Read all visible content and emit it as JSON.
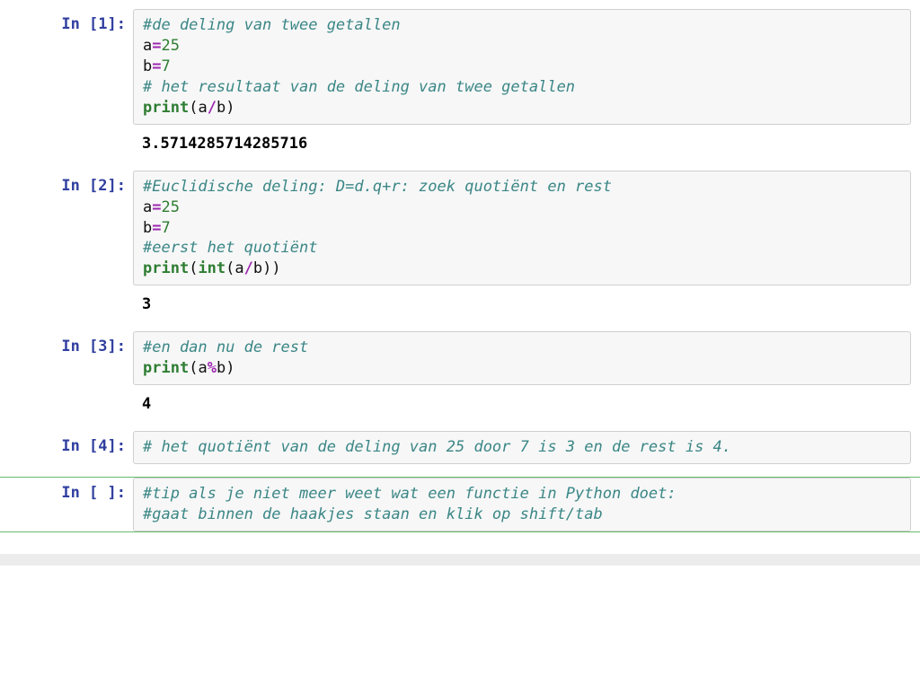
{
  "cells": [
    {
      "prompt": "In [1]:",
      "code": [
        {
          "t": "c",
          "v": "#de deling van twee getallen"
        },
        [
          {
            "t": "n",
            "v": "a"
          },
          {
            "t": "o",
            "v": "="
          },
          {
            "t": "num",
            "v": "25"
          }
        ],
        [
          {
            "t": "n",
            "v": "b"
          },
          {
            "t": "o",
            "v": "="
          },
          {
            "t": "num",
            "v": "7"
          }
        ],
        {
          "t": "c",
          "v": "# het resultaat van de deling van twee getallen"
        },
        [
          {
            "t": "k",
            "v": "print"
          },
          {
            "t": "p",
            "v": "("
          },
          {
            "t": "n",
            "v": "a"
          },
          {
            "t": "o",
            "v": "/"
          },
          {
            "t": "n",
            "v": "b"
          },
          {
            "t": "p",
            "v": ")"
          }
        ]
      ],
      "output": "3.5714285714285716"
    },
    {
      "prompt": "In [2]:",
      "code": [
        {
          "t": "c",
          "v": "#Euclidische deling: D=d.q+r: zoek quotiënt en rest"
        },
        [
          {
            "t": "n",
            "v": "a"
          },
          {
            "t": "o",
            "v": "="
          },
          {
            "t": "num",
            "v": "25"
          }
        ],
        [
          {
            "t": "n",
            "v": "b"
          },
          {
            "t": "o",
            "v": "="
          },
          {
            "t": "num",
            "v": "7"
          }
        ],
        {
          "t": "c",
          "v": "#eerst het quotiënt"
        },
        [
          {
            "t": "k",
            "v": "print"
          },
          {
            "t": "p",
            "v": "("
          },
          {
            "t": "k",
            "v": "int"
          },
          {
            "t": "p",
            "v": "("
          },
          {
            "t": "n",
            "v": "a"
          },
          {
            "t": "o",
            "v": "/"
          },
          {
            "t": "n",
            "v": "b"
          },
          {
            "t": "p",
            "v": "))"
          }
        ]
      ],
      "output": "3"
    },
    {
      "prompt": "In [3]:",
      "code": [
        {
          "t": "c",
          "v": "#en dan nu de rest"
        },
        [
          {
            "t": "k",
            "v": "print"
          },
          {
            "t": "p",
            "v": "("
          },
          {
            "t": "n",
            "v": "a"
          },
          {
            "t": "o",
            "v": "%"
          },
          {
            "t": "n",
            "v": "b"
          },
          {
            "t": "p",
            "v": ")"
          }
        ]
      ],
      "output": "4"
    },
    {
      "prompt": "In [4]:",
      "code": [
        {
          "t": "c",
          "v": "# het quotiënt van de deling van 25 door 7 is 3 en de rest is 4."
        }
      ],
      "output": null,
      "selected": false
    },
    {
      "prompt": "In [ ]:",
      "code": [
        {
          "t": "c",
          "v": "#tip als je niet meer weet wat een functie in Python doet:"
        },
        {
          "t": "c",
          "v": "#gaat binnen de haakjes staan en klik op shift/tab"
        }
      ],
      "output": null,
      "selected": true
    }
  ]
}
